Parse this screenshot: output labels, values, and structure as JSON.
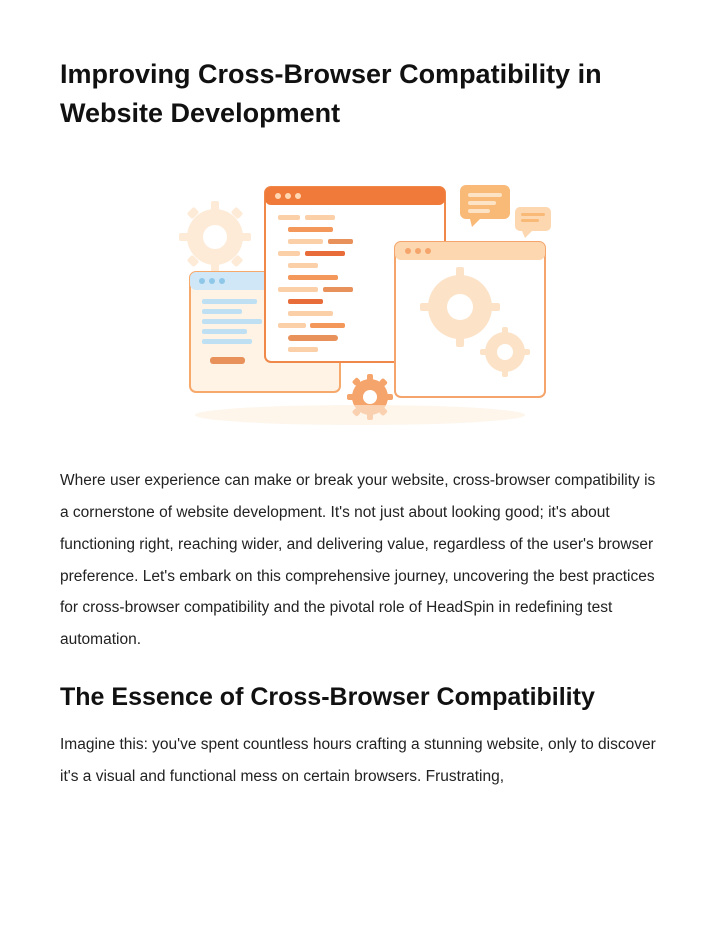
{
  "article": {
    "title": "Improving Cross-Browser Compatibility in Website Development",
    "intro_paragraph": "Where user experience can make or break your website, cross-browser compatibility is a cornerstone of website development. It's not just about looking good; it's about functioning right, reaching wider, and delivering value, regardless of the user's browser preference. Let's embark on this comprehensive journey, uncovering the best practices for cross-browser compatibility and the pivotal role of HeadSpin in redefining test automation.",
    "section1_heading": "The Essence of Cross-Browser Compatibility",
    "section1_paragraph": "Imagine this: you've spent countless hours crafting a stunning website, only to discover it's a visual and functional mess on certain browsers. Frustrating,"
  }
}
